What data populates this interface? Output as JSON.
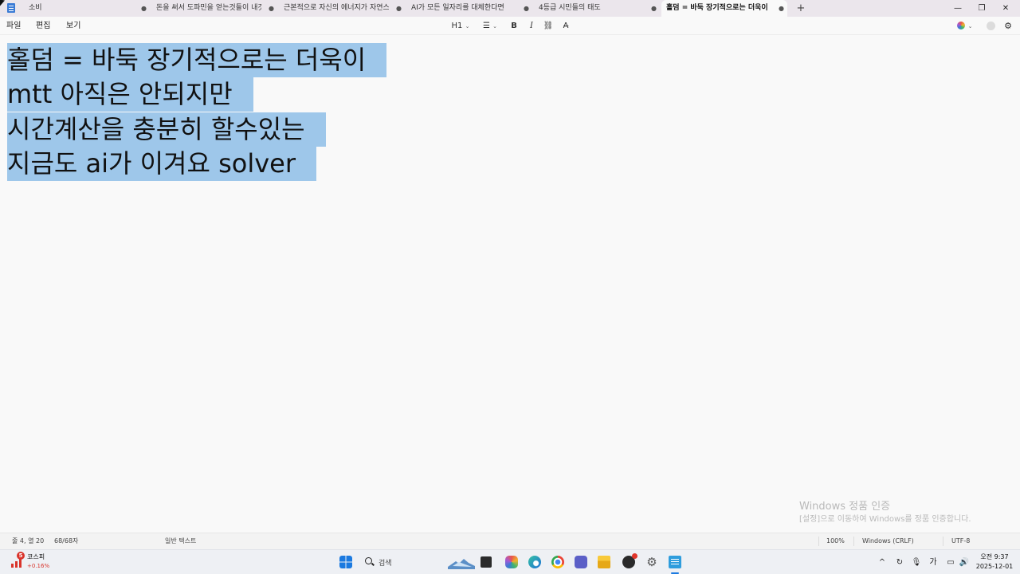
{
  "tabs": [
    {
      "label": "소비",
      "marker": "●"
    },
    {
      "label": "돈을 써서 도파민을 얻는것들이 내것",
      "marker": "●"
    },
    {
      "label": "근본적으로 자신의 에너지가 자연스",
      "marker": "●"
    },
    {
      "label": "AI가  모든 일자리를 대체한다면",
      "marker": "●"
    },
    {
      "label": "4등급 시민들의 태도",
      "marker": "●"
    },
    {
      "label": "홀덤 = 바둑 장기적으로는 더욱이",
      "marker": "●"
    }
  ],
  "new_tab": "+",
  "window_controls": {
    "minimize": "—",
    "restore": "❐",
    "close": "✕"
  },
  "menu": {
    "file": "파일",
    "edit": "편집",
    "view": "보기"
  },
  "toolbar": {
    "heading": "H1",
    "list": "☰",
    "bold": "B",
    "italic": "I",
    "link": "⛓",
    "spell": "A̶"
  },
  "document": {
    "lines": [
      "홀덤 = 바둑 장기적으로는 더욱이",
      "mtt 아직은 안되지만",
      "시간계산을 충분히 할수있는",
      "지금도 ai가 이겨요 solver"
    ]
  },
  "watermark": {
    "title": "Windows 정품 인증",
    "subtitle": "[설정]으로 이동하여 Windows를 정품 인증합니다."
  },
  "status": {
    "position": "줄 4, 열 20",
    "chars": "68/68자",
    "format": "일반 텍스트",
    "zoom": "100%",
    "line_ending": "Windows (CRLF)",
    "encoding": "UTF-8"
  },
  "taskbar": {
    "stock_badge": "5",
    "stock_name": "코스피",
    "stock_change": "+0.16%",
    "search_placeholder": "검색",
    "ime": "가",
    "time": "오전 9:37",
    "date": "2025-12-01"
  },
  "colors": {
    "selection": "#9ec7ea",
    "titlebar": "#ebe6ec",
    "accent": "#3a7bd5"
  }
}
